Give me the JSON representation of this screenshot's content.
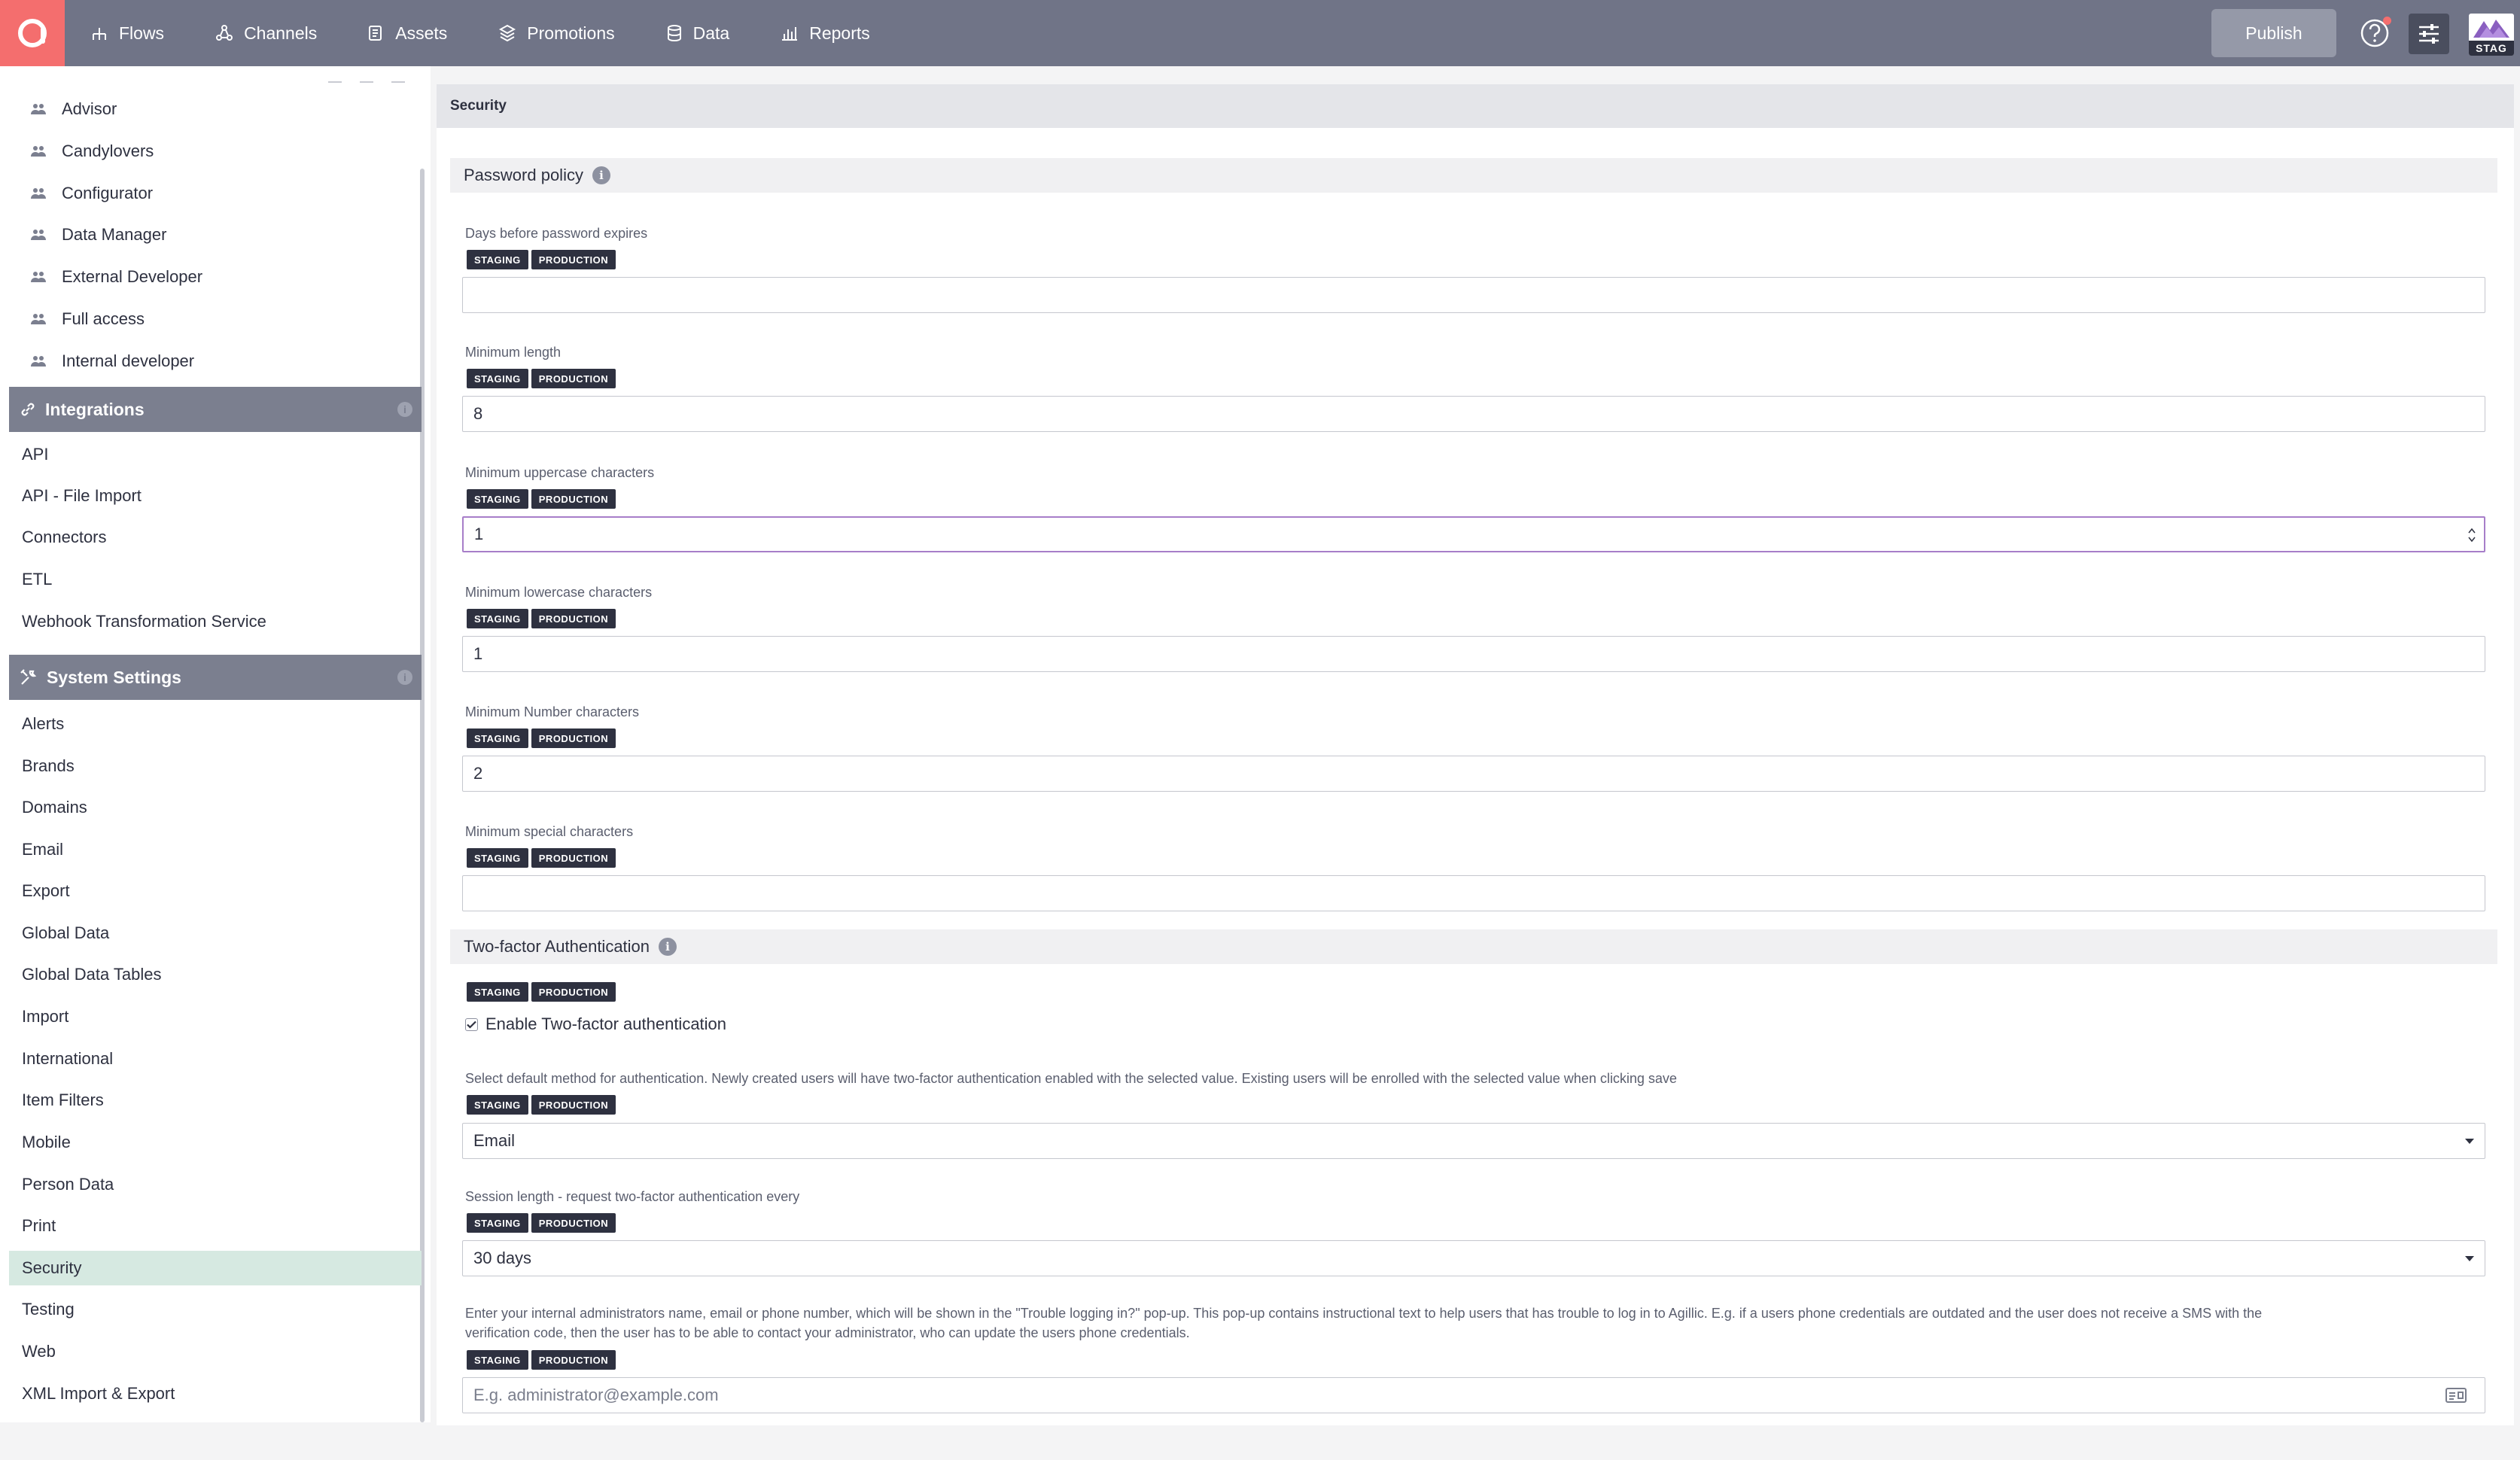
{
  "topbar": {
    "logo_letter": "a",
    "nav": [
      {
        "label": "Flows",
        "icon": "flows-icon"
      },
      {
        "label": "Channels",
        "icon": "channels-icon"
      },
      {
        "label": "Assets",
        "icon": "assets-icon"
      },
      {
        "label": "Promotions",
        "icon": "promotions-icon"
      },
      {
        "label": "Data",
        "icon": "data-icon"
      },
      {
        "label": "Reports",
        "icon": "reports-icon"
      }
    ],
    "publish_label": "Publish",
    "env_label": "STAG",
    "accent_color": "#f46e6e",
    "bar_color": "#707487"
  },
  "sidebar": {
    "roles": [
      "Advisor",
      "Candylovers",
      "Configurator",
      "Data Manager",
      "External Developer",
      "Full access",
      "Internal developer"
    ],
    "integrations": {
      "title": "Integrations",
      "items": [
        "API",
        "API - File Import",
        "Connectors",
        "ETL",
        "Webhook Transformation Service"
      ]
    },
    "system_settings": {
      "title": "System Settings",
      "items": [
        "Alerts",
        "Brands",
        "Domains",
        "Email",
        "Export",
        "Global Data",
        "Global Data Tables",
        "Import",
        "International",
        "Item Filters",
        "Mobile",
        "Person Data",
        "Print",
        "Security",
        "Testing",
        "Web",
        "XML Import & Export"
      ],
      "active": "Security"
    }
  },
  "main": {
    "title": "Security",
    "tags": {
      "staging": "STAGING",
      "production": "PRODUCTION"
    },
    "password_policy": {
      "title": "Password policy",
      "fields": [
        {
          "label": "Days before password expires",
          "value": ""
        },
        {
          "label": "Minimum length",
          "value": "8"
        },
        {
          "label": "Minimum uppercase characters",
          "value": "1"
        },
        {
          "label": "Minimum lowercase characters",
          "value": "1"
        },
        {
          "label": "Minimum Number characters",
          "value": "2"
        },
        {
          "label": "Minimum special characters",
          "value": ""
        }
      ]
    },
    "two_factor": {
      "title": "Two-factor Authentication",
      "enable_label": "Enable Two-factor authentication",
      "enabled": true,
      "method_desc": "Select default method for authentication. Newly created users will have two-factor authentication enabled with the selected value. Existing users will be enrolled with the selected value when clicking save",
      "method_value": "Email",
      "session_label": "Session length - request two-factor authentication every",
      "session_value": "30 days",
      "contact_desc_1": "Enter your internal administrators name, email or phone number, which will be shown in the \"Trouble logging in?\" pop-up. This pop-up contains instructional text to help users that has trouble to log in to Agillic. E.g. if a users phone credentials are outdated and the user does not receive a SMS with the",
      "contact_desc_2": "verification code, then the user has to be able to contact your administrator, who can update the users phone credentials.",
      "contact_placeholder": "E.g. administrator@example.com"
    }
  }
}
